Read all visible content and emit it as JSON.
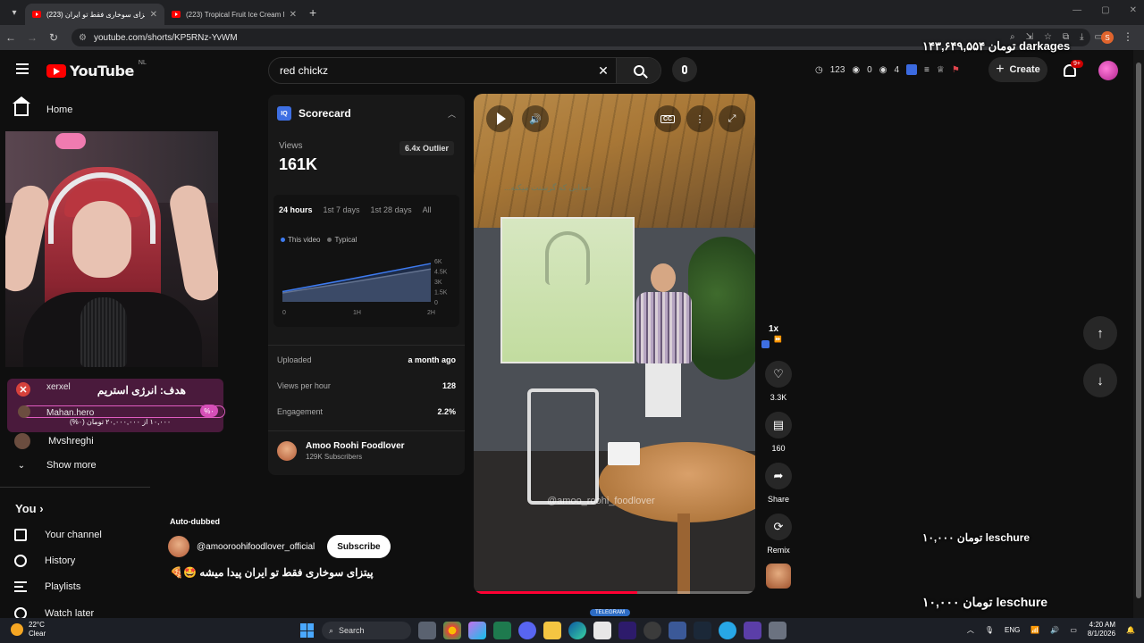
{
  "browser": {
    "tabs": [
      {
        "title": "پیتزای سوخاری فقط تو ایران (223)",
        "active": true
      },
      {
        "title": "(223) Tropical Fruit Ice Cream M",
        "active": false
      }
    ],
    "url": "youtube.com/shorts/KP5RNz-YvWM"
  },
  "overlays": {
    "top_donation": "۱۴۳,۶۴۹,۵۵۴ تومان darkages",
    "mid_donation": "۱۰,۰۰۰ تومان leschure",
    "bottom_donation": "۱۰,۰۰۰ تومان leschure",
    "goal_title": "هدف: انرژی استریم",
    "goal_amount": "۱۰,۰۰۰ از ۲۰,۰۰۰,۰۰۰ تومان (۰%)",
    "goal_pct": "%۰",
    "goal_progress": 0,
    "goal_user_1": "xerxel",
    "goal_user_2": "Mahan.hero"
  },
  "header": {
    "logo_text": "YouTube",
    "region": "NL",
    "search_query": "red chickz",
    "stats": {
      "clock": "123",
      "eye1": "0",
      "eye2": "4"
    },
    "create_label": "Create",
    "notif_badge": "9+"
  },
  "sidebar": {
    "home": "Home",
    "sub_channel": "Mvshreghi",
    "show_more": "Show more",
    "you_heading": "You",
    "you_items": [
      "Your channel",
      "History",
      "Playlists",
      "Watch later"
    ]
  },
  "scorecard": {
    "title": "Scorecard",
    "views_label": "Views",
    "views": "161K",
    "outlier": "6.4x Outlier",
    "tabs": [
      "24 hours",
      "1st 7 days",
      "1st 28 days",
      "All"
    ],
    "legend": [
      "This video",
      "Typical"
    ],
    "rows": [
      {
        "k": "Uploaded",
        "v": "a month ago"
      },
      {
        "k": "Views per hour",
        "v": "128"
      },
      {
        "k": "Engagement",
        "v": "2.2%"
      }
    ],
    "channel_name": "Amoo Roohi Foodlover",
    "channel_subs": "129K Subscribers"
  },
  "chart_data": {
    "type": "area",
    "x_ticks": [
      "0",
      "1H",
      "2H"
    ],
    "y_ticks": [
      "6K",
      "4.5K",
      "3K",
      "1.5K",
      "0"
    ],
    "ylim": [
      0,
      6000
    ],
    "series": [
      {
        "name": "This video",
        "color": "#3e7bf0",
        "x": [
          0,
          1,
          2
        ],
        "values": [
          1500,
          3500,
          5600
        ]
      },
      {
        "name": "Typical",
        "color": "#6f6f6f",
        "x": [
          0,
          1,
          2
        ],
        "values": [
          1300,
          3000,
          4800
        ]
      }
    ]
  },
  "short": {
    "watermark": "@amoo_roohi_foodlover",
    "screen_text": "صدایی که گرسنت میکنه...",
    "progress": 0.58,
    "channel_handle": "@amooroohifoodlover_official",
    "subscribe": "Subscribe",
    "auto_dubbed": "Auto-dubbed",
    "caption": "پیتزای سوخاری فقط تو ایران پیدا میشه 🤩🍕",
    "telegram": "TELEGRAM"
  },
  "actions": {
    "speed": "1x",
    "likes": "3.3K",
    "comments": "160",
    "share": "Share",
    "remix": "Remix"
  },
  "taskbar": {
    "temp": "22°C",
    "weather": "Clear",
    "search": "Search",
    "lang": "ENG",
    "time": "4:20 AM",
    "date": "8/1/2026"
  }
}
